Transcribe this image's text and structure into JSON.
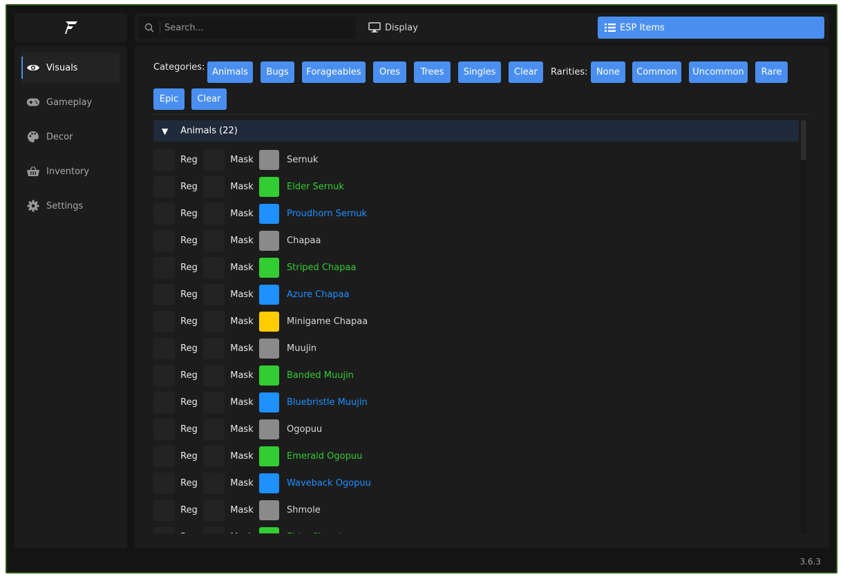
{
  "app": {
    "version": "3.6.3",
    "logo_glyph": "F"
  },
  "search": {
    "placeholder": "Search..."
  },
  "tabs": [
    {
      "label": "Display",
      "icon": "monitor-icon"
    },
    {
      "label": "ESP Items",
      "icon": "list-icon",
      "active": true
    }
  ],
  "sidebar": {
    "items": [
      {
        "label": "Visuals",
        "icon": "eye-icon",
        "active": true
      },
      {
        "label": "Gameplay",
        "icon": "gamepad-icon"
      },
      {
        "label": "Decor",
        "icon": "palette-icon"
      },
      {
        "label": "Inventory",
        "icon": "basket-icon"
      },
      {
        "label": "Settings",
        "icon": "gear-icon"
      }
    ]
  },
  "filters": {
    "categories_label": "Categories:",
    "categories": [
      "Animals",
      "Bugs",
      "Forageables",
      "Ores",
      "Trees",
      "Singles",
      "Clear"
    ],
    "rarities_label": "Rarities:",
    "rarities": [
      "None",
      "Common",
      "Uncommon",
      "Rare",
      "Epic",
      "Clear"
    ]
  },
  "group": {
    "title": "Animals (22)",
    "expanded_icon": "triangle-down-icon"
  },
  "row_labels": {
    "reg": "Reg",
    "mask": "Mask"
  },
  "colors": {
    "common": "#8a8a8a",
    "uncommon": "#33cc33",
    "rare": "#1e90ff",
    "epic": "#ffcc00",
    "accent": "#4a8ff0"
  },
  "items": [
    {
      "name": "Sernuk",
      "rarity": "common"
    },
    {
      "name": "Elder Sernuk",
      "rarity": "uncommon"
    },
    {
      "name": "Proudhorn Sernuk",
      "rarity": "rare"
    },
    {
      "name": "Chapaa",
      "rarity": "common"
    },
    {
      "name": "Striped Chapaa",
      "rarity": "uncommon"
    },
    {
      "name": "Azure Chapaa",
      "rarity": "rare"
    },
    {
      "name": "Minigame Chapaa",
      "rarity": "epic"
    },
    {
      "name": "Muujin",
      "rarity": "common"
    },
    {
      "name": "Banded Muujin",
      "rarity": "uncommon"
    },
    {
      "name": "Bluebristle Muujin",
      "rarity": "rare"
    },
    {
      "name": "Ogopuu",
      "rarity": "common"
    },
    {
      "name": "Emerald Ogopuu",
      "rarity": "uncommon"
    },
    {
      "name": "Waveback Ogopuu",
      "rarity": "rare"
    },
    {
      "name": "Shmole",
      "rarity": "common"
    },
    {
      "name": "Elder Shmole",
      "rarity": "uncommon"
    }
  ]
}
